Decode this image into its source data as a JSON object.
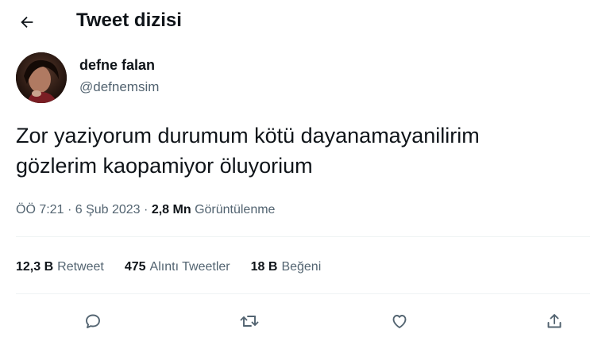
{
  "header": {
    "back_icon": "arrow-left-icon",
    "title": "Tweet dizisi"
  },
  "author": {
    "avatar_icon": "profile-photo",
    "name": "defne falan",
    "handle": "@defnemsim"
  },
  "tweet": {
    "lines": [
      "Zor yaziyorum durumum kötü dayanamayanilirim",
      "gözlerim kaopamiyor öluyorium"
    ]
  },
  "meta": {
    "time": "ÖÖ 7:21",
    "separator1": "·",
    "date": "6 Şub 2023",
    "separator2": "·",
    "views_count": "2,8 Mn",
    "views_label": "Görüntülenme"
  },
  "stats": {
    "retweets_count": "12,3 B",
    "retweets_label": "Retweet",
    "quotes_count": "475",
    "quotes_label": "Alıntı Tweetler",
    "likes_count": "18 B",
    "likes_label": "Beğeni"
  },
  "actions": {
    "reply_icon": "reply-icon",
    "retweet_icon": "retweet-icon",
    "like_icon": "heart-icon",
    "share_icon": "share-icon"
  },
  "colors": {
    "text_primary": "#0f1419",
    "text_secondary": "#536471",
    "divider": "#eff3f4"
  }
}
